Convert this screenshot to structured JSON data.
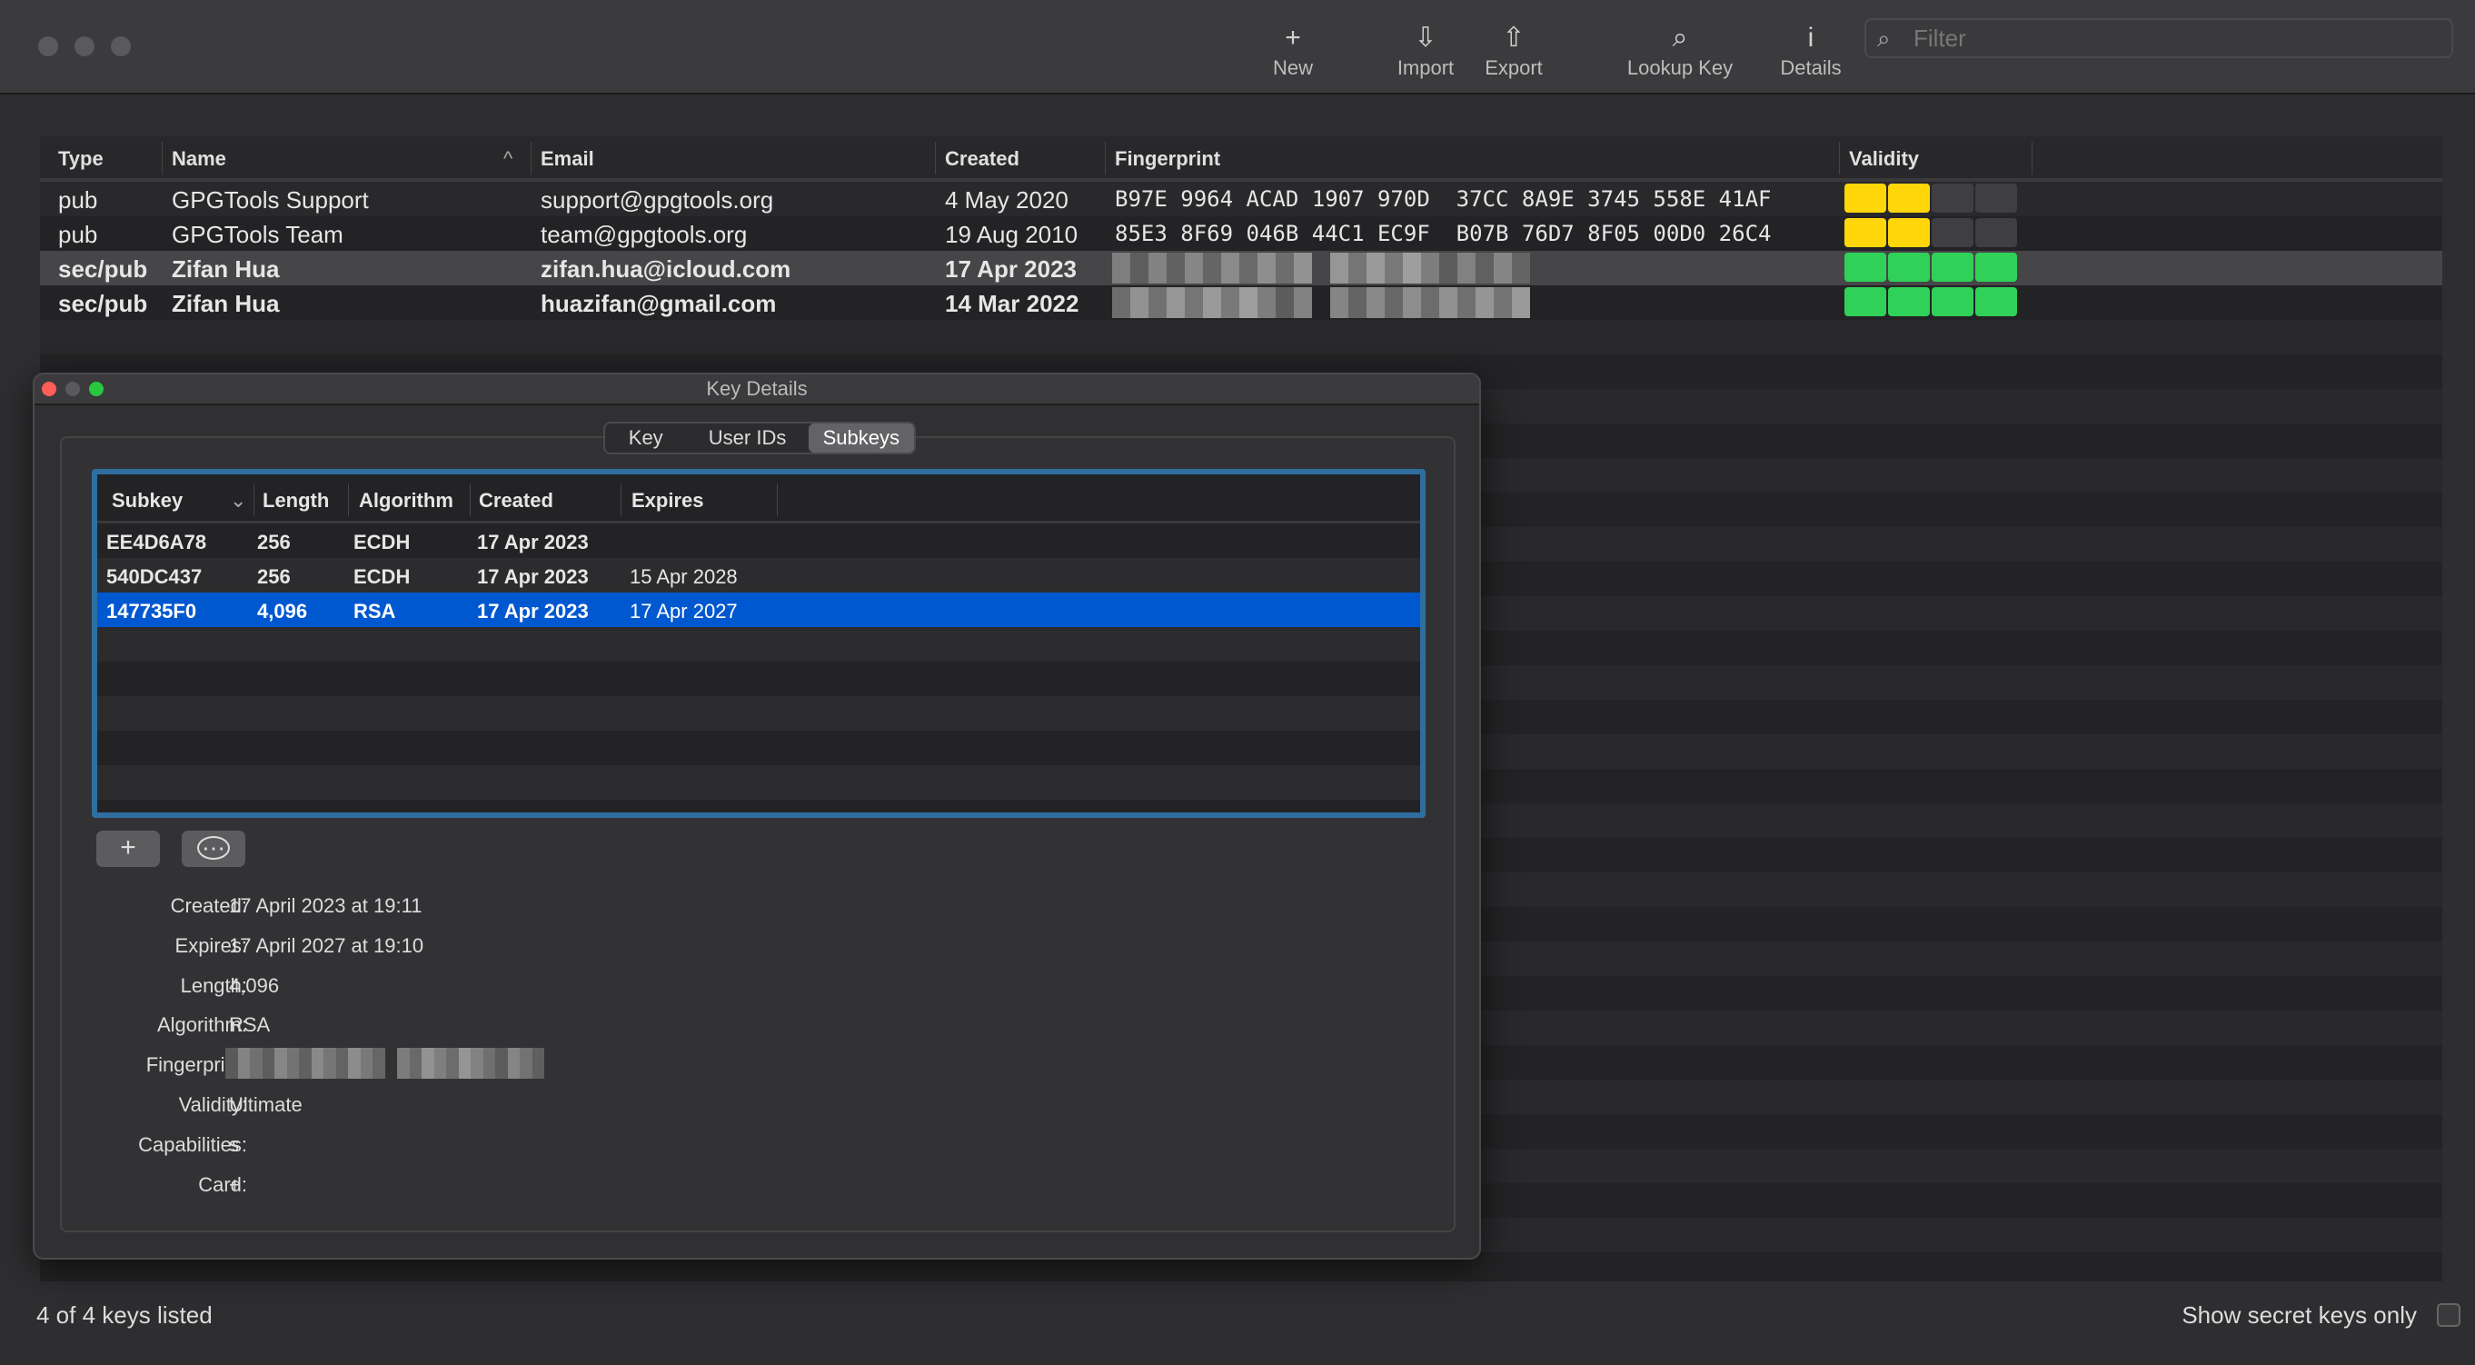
{
  "toolbar": {
    "new": "New",
    "import": "Import",
    "export": "Export",
    "lookup": "Lookup Key",
    "details": "Details",
    "filter_placeholder": "Filter",
    "icons": {
      "new": "plus-icon",
      "import": "import-tray-icon",
      "export": "share-icon",
      "lookup": "magnifier-icon",
      "details": "info-icon"
    }
  },
  "keylist": {
    "columns": [
      "Type",
      "Name",
      "Email",
      "Created",
      "Fingerprint",
      "Validity"
    ],
    "rows": [
      {
        "type": "pub",
        "name": "GPGTools Support",
        "email": "support@gpgtools.org",
        "created": "4 May 2020",
        "fingerprint": "B97E 9964 ACAD 1907 970D  37CC 8A9E 3745 558E 41AF",
        "validity": 2,
        "color": "#ffd60a"
      },
      {
        "type": "pub",
        "name": "GPGTools Team",
        "email": "team@gpgtools.org",
        "created": "19 Aug 2010",
        "fingerprint": "85E3 8F69 046B 44C1 EC9F  B07B 76D7 8F05 00D0 26C4",
        "validity": 2,
        "color": "#ffd60a"
      },
      {
        "type": "sec/pub",
        "name": "Zifan Hua",
        "email": "zifan.hua@icloud.com",
        "created": "17 Apr 2023",
        "validity": 4,
        "color": "#30d158"
      },
      {
        "type": "sec/pub",
        "name": "Zifan Hua",
        "email": "huazifan@gmail.com",
        "created": "14 Mar 2022",
        "validity": 4,
        "color": "#30d158"
      }
    ]
  },
  "status": {
    "count": "4 of 4 keys listed",
    "secret_only": "Show secret keys only"
  },
  "dialog": {
    "title": "Key Details",
    "tabs": [
      "Key",
      "User IDs",
      "Subkeys"
    ],
    "subkeys": {
      "columns": [
        "Subkey",
        "Length",
        "Algorithm",
        "Created",
        "Expires"
      ],
      "rows": [
        {
          "id": "EE4D6A78",
          "length": "256",
          "algorithm": "ECDH",
          "created": "17 Apr 2023",
          "expires": ""
        },
        {
          "id": "540DC437",
          "length": "256",
          "algorithm": "ECDH",
          "created": "17 Apr 2023",
          "expires": "15 Apr 2028"
        },
        {
          "id": "147735F0",
          "length": "4,096",
          "algorithm": "RSA",
          "created": "17 Apr 2023",
          "expires": "17 Apr 2027"
        }
      ]
    },
    "add_label": "+",
    "more_label": "⋯",
    "details": [
      {
        "label": "Created:",
        "value": "17 April 2023 at 19:11"
      },
      {
        "label": "Expires:",
        "value": "17 April 2027 at 19:10"
      },
      {
        "label": "Length:",
        "value": "4,096"
      },
      {
        "label": "Algorithm:",
        "value": "RSA"
      },
      {
        "label": "Fingerprint:",
        "value": ""
      },
      {
        "label": "Validity:",
        "value": "Ultimate"
      },
      {
        "label": "Capabilities:",
        "value": "s"
      },
      {
        "label": "Card:",
        "value": "+"
      }
    ]
  }
}
